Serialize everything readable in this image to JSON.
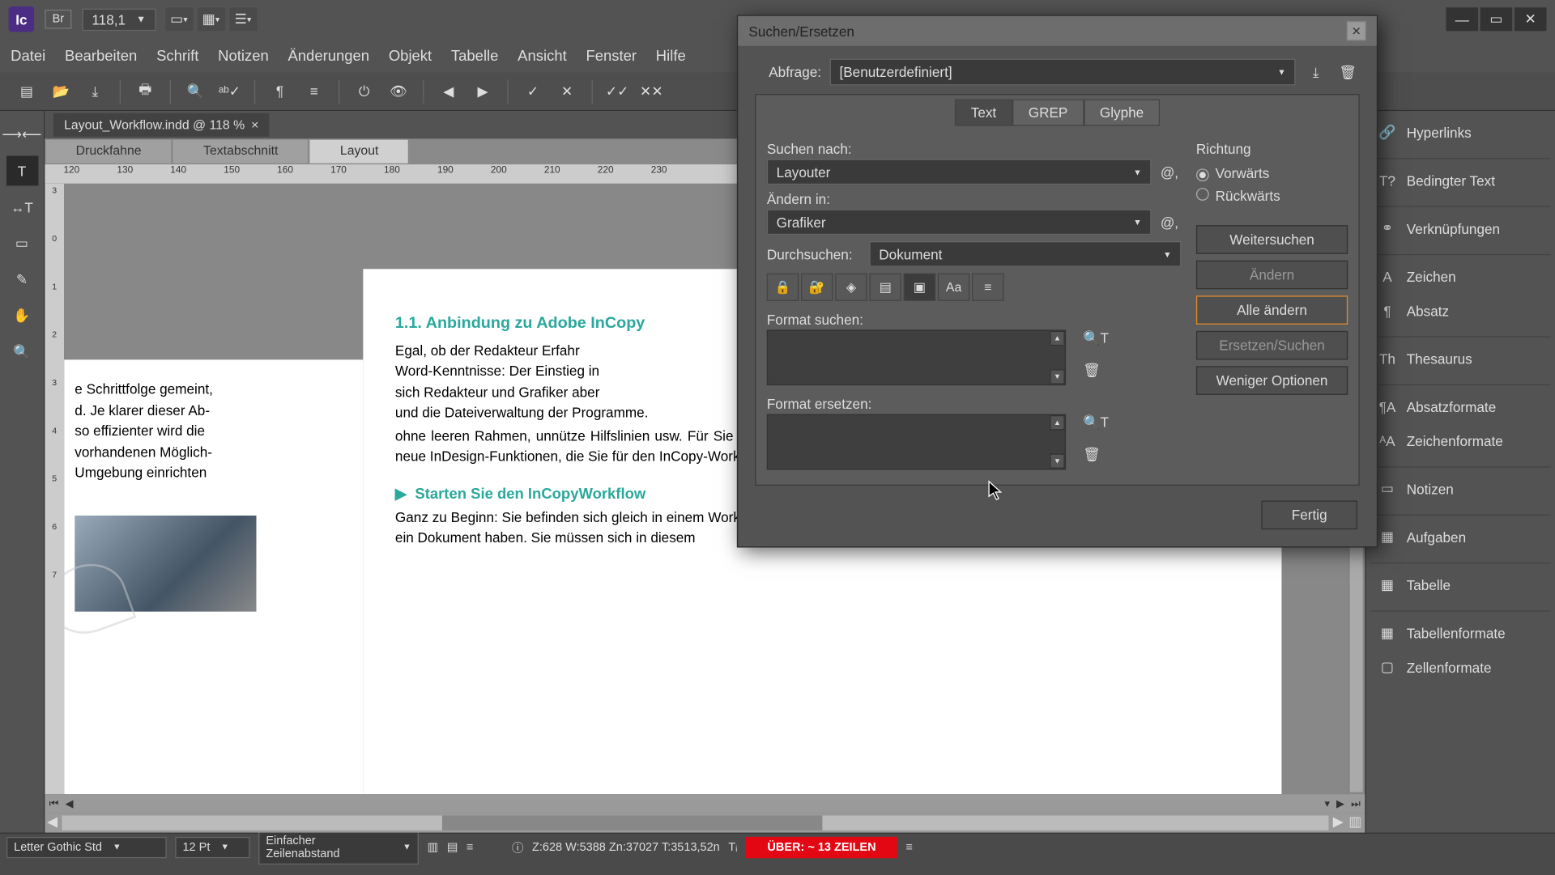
{
  "app": {
    "logo": "Ic",
    "bridge": "Br",
    "zoom": "118,1"
  },
  "window_controls": {
    "min": "—",
    "max": "▭",
    "close": "✕"
  },
  "menu": [
    "Datei",
    "Bearbeiten",
    "Schrift",
    "Notizen",
    "Änderungen",
    "Objekt",
    "Tabelle",
    "Ansicht",
    "Fenster",
    "Hilfe"
  ],
  "doc": {
    "tab": "Layout_Workflow.indd @ 118 %",
    "tab_close": "×",
    "view_tabs": [
      "Druckfahne",
      "Textabschnitt",
      "Layout"
    ],
    "ruler_h": [
      "120",
      "130",
      "140",
      "150",
      "160",
      "170",
      "180",
      "190",
      "200",
      "210",
      "220",
      "230"
    ],
    "ruler_v": [
      "3",
      "",
      "0",
      "",
      "1",
      "",
      "2",
      "",
      "3",
      "",
      "4",
      "",
      "5",
      "",
      "6",
      "",
      "7"
    ],
    "col1": "e Schrittfolge gemeint,\nd. Je klarer dieser Ab-\nso effizienter wird die\nvorhandenen Möglich-\n Umgebung einrichten",
    "h1": "1.1.  Anbindung zu Adobe InCopy",
    "p1": "Egal, ob der Redakteur Erfahr\nWord-Kenntnisse: Der Einstieg in\nsich Redakteur und Grafiker aber\nund die Dateiverwaltung der Programme.",
    "p2": "ohne leeren Rahmen, unnütze Hilfslinien usw. Für Sie als  gibt es ein paar bekannte, aber auch neue InDesign-Funktionen, die Sie für den InCopy-Workflow benötigen.",
    "h2": "Starten Sie den InCopyWorkflow",
    "p3": "Ganz zu Beginn: Sie befinden sich gleich in einem Workflow, in dem meh­rere Kollegen Zugriff auf ein Dokument haben. Sie müssen sich in diesem"
  },
  "right_panels": [
    "Hyperlinks",
    "Bedingter Text",
    "Verknüpfungen",
    "Zeichen",
    "Absatz",
    "Thesaurus",
    "Absatzformate",
    "Zeichenformate",
    "Notizen",
    "Aufgaben",
    "Tabelle",
    "Tabellenformate",
    "Zellenformate"
  ],
  "status": {
    "font": "Letter Gothic Std",
    "size": "12 Pt",
    "leading": "Einfacher Zeilenabstand",
    "coords": "Z:628    W:5388    Zn:37027   T:3513,52n",
    "warn": "ÜBER:  ~ 13 ZEILEN"
  },
  "dialog": {
    "title": "Suchen/Ersetzen",
    "query_label": "Abfrage:",
    "query_value": "[Benutzerdefiniert]",
    "tabs": [
      "Text",
      "GREP",
      "Glyphe"
    ],
    "find_label": "Suchen nach:",
    "find_value": "Layouter",
    "change_label": "Ändern in:",
    "change_value": "Grafiker",
    "scope_label": "Durchsuchen:",
    "scope_value": "Dokument",
    "dir_title": "Richtung",
    "dir_fwd": "Vorwärts",
    "dir_back": "Rückwärts",
    "btn_next": "Weitersuchen",
    "btn_change": "Ändern",
    "btn_change_all": "Alle ändern",
    "btn_change_find": "Ersetzen/Suchen",
    "btn_less": "Weniger Optionen",
    "fmt_find": "Format suchen:",
    "fmt_replace": "Format ersetzen:",
    "done": "Fertig"
  }
}
